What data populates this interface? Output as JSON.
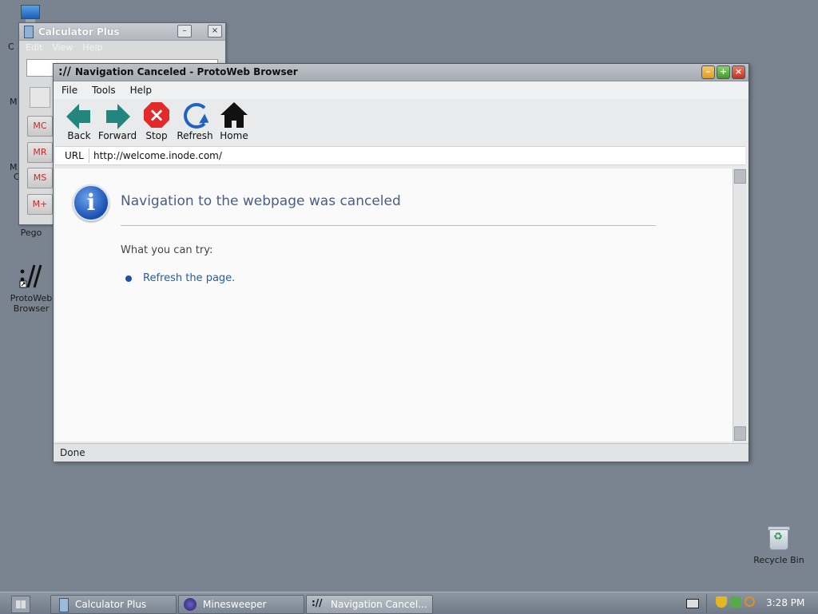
{
  "desktop": {
    "icons": {
      "pego": "Pego",
      "protoweb_line1": "ProtoWeb",
      "protoweb_line2": "Browser",
      "recycle_bin": "Recycle Bin",
      "partial_c": "C",
      "partial_m1": "M",
      "partial_m2": "M",
      "partial_c2": "C"
    }
  },
  "calculator": {
    "title": "Calculator Plus",
    "menu": [
      "Edit",
      "View",
      "Help"
    ],
    "buttons": [
      "MC",
      "MR",
      "MS",
      "M+"
    ]
  },
  "browser": {
    "logo": "://",
    "title": "Navigation Canceled - ProtoWeb Browser",
    "menu": [
      "File",
      "Tools",
      "Help"
    ],
    "toolbar": {
      "back": "Back",
      "forward": "Forward",
      "stop": "Stop",
      "refresh": "Refresh",
      "home": "Home"
    },
    "url_label": "URL",
    "url_value": "http://welcome.inode.com/",
    "page": {
      "heading": "Navigation to the webpage was canceled",
      "try_label": "What you can try:",
      "refresh_link": "Refresh the page."
    },
    "status": "Done"
  },
  "taskbar": {
    "tasks": [
      "Calculator Plus",
      "Minesweeper",
      "Navigation Cancel..."
    ],
    "clock": "3:28 PM"
  },
  "colors": {
    "desktop_bg": "#7a8491",
    "accent_teal": "#23867e",
    "stop_red": "#e32a2a",
    "refresh_blue": "#1f63c2",
    "heading_blue": "#4a5d87",
    "link_blue": "#1f5ea8"
  },
  "icons": [
    "my-computer-icon",
    "protoweb-icon",
    "recycle-bin-icon",
    "back-arrow-icon",
    "forward-arrow-icon",
    "stop-icon",
    "refresh-icon",
    "home-icon",
    "info-icon"
  ]
}
